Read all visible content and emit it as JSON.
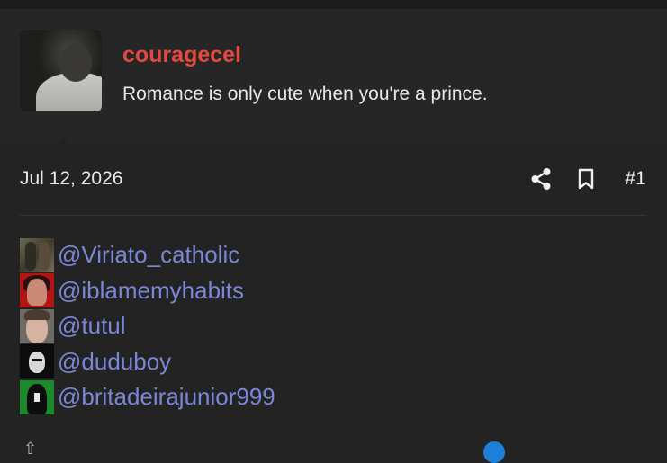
{
  "post": {
    "username": "couragecel",
    "user_title": "Romance is only cute when you're a prince.",
    "date": "Jul 12, 2026",
    "post_number": "#1",
    "accent_color": "#e5483e",
    "link_color": "#7b86d6"
  },
  "mentions": [
    {
      "handle": "@Viriato_catholic"
    },
    {
      "handle": "@iblamemyhabits"
    },
    {
      "handle": "@tutul"
    },
    {
      "handle": "@duduboy"
    },
    {
      "handle": "@britadeirajunior999"
    }
  ],
  "icons": {
    "share": "share-icon",
    "bookmark": "bookmark-icon"
  }
}
